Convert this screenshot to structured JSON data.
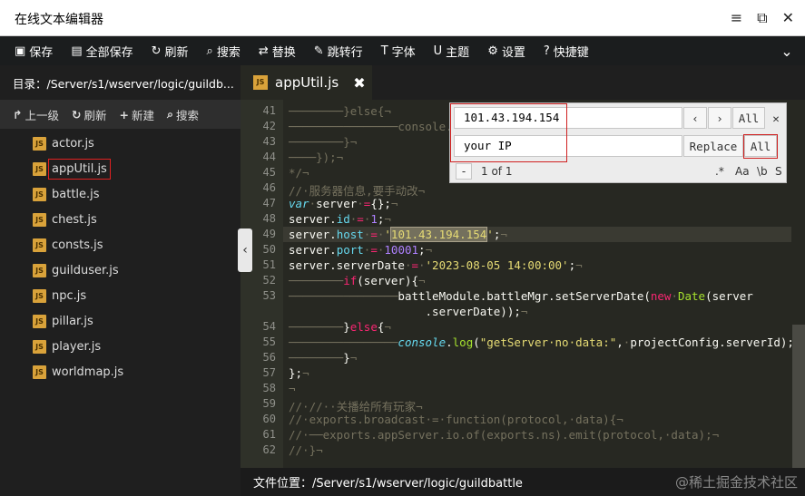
{
  "window": {
    "title": "在线文本编辑器",
    "controls": [
      "≡",
      "⧉",
      "✕"
    ]
  },
  "toolbar": {
    "items": [
      {
        "icon": "save-icon",
        "glyph": "▣",
        "label": "保存"
      },
      {
        "icon": "save-all-icon",
        "glyph": "▤",
        "label": "全部保存"
      },
      {
        "icon": "refresh-icon",
        "glyph": "↻",
        "label": "刷新"
      },
      {
        "icon": "search-icon",
        "glyph": "⌕",
        "label": "搜索"
      },
      {
        "icon": "replace-icon",
        "glyph": "⇄",
        "label": "替换"
      },
      {
        "icon": "goto-line-icon",
        "glyph": "✎",
        "label": "跳转行"
      },
      {
        "icon": "font-icon",
        "glyph": "T",
        "label": "字体"
      },
      {
        "icon": "theme-icon",
        "glyph": "U",
        "label": "主题"
      },
      {
        "icon": "settings-icon",
        "glyph": "⚙",
        "label": "设置"
      },
      {
        "icon": "help-icon",
        "glyph": "?",
        "label": "快捷键"
      }
    ],
    "more": "⌄"
  },
  "sidebar": {
    "directory": "目录：/Server/s1/wserver/logic/guildb...",
    "tools": [
      {
        "glyph": "↱",
        "label": "上一级"
      },
      {
        "glyph": "↻",
        "label": "刷新"
      },
      {
        "glyph": "+",
        "label": "新建"
      },
      {
        "glyph": "⌕",
        "label": "搜索"
      }
    ],
    "files": [
      "actor.js",
      "appUtil.js",
      "battle.js",
      "chest.js",
      "consts.js",
      "guilduser.js",
      "npc.js",
      "pillar.js",
      "player.js",
      "worldmap.js"
    ],
    "active_file": "appUtil.js",
    "js_badge": "JS"
  },
  "tab": {
    "label": "appUtil.js",
    "badge": "JS",
    "close": "✖"
  },
  "editor": {
    "line_numbers": [
      "41",
      "42",
      "43",
      "44",
      "45",
      "46",
      "47",
      "48",
      "49",
      "50",
      "51",
      "52",
      "53",
      "",
      "54",
      "55",
      "56",
      "57",
      "58",
      "59",
      "60",
      "61",
      "62"
    ]
  },
  "search": {
    "find_value": "101.43.194.154",
    "replace_value": "your IP",
    "prev": "‹",
    "next": "›",
    "find_all": "All",
    "close": "✕",
    "replace": "Replace",
    "replace_all": "All",
    "toggle": "-",
    "count": "1 of 1",
    "opt_regex": ".*",
    "opt_case": "Aa",
    "opt_word": "\\b",
    "opt_sel": "S"
  },
  "status": {
    "path": "文件位置：/Server/s1/wserver/logic/guildbattle"
  },
  "watermark": "@稀土掘金技术社区",
  "colors": {
    "match_bg": "#74705d",
    "annotation_red": "#d02020",
    "editor_bg": "#272822"
  }
}
